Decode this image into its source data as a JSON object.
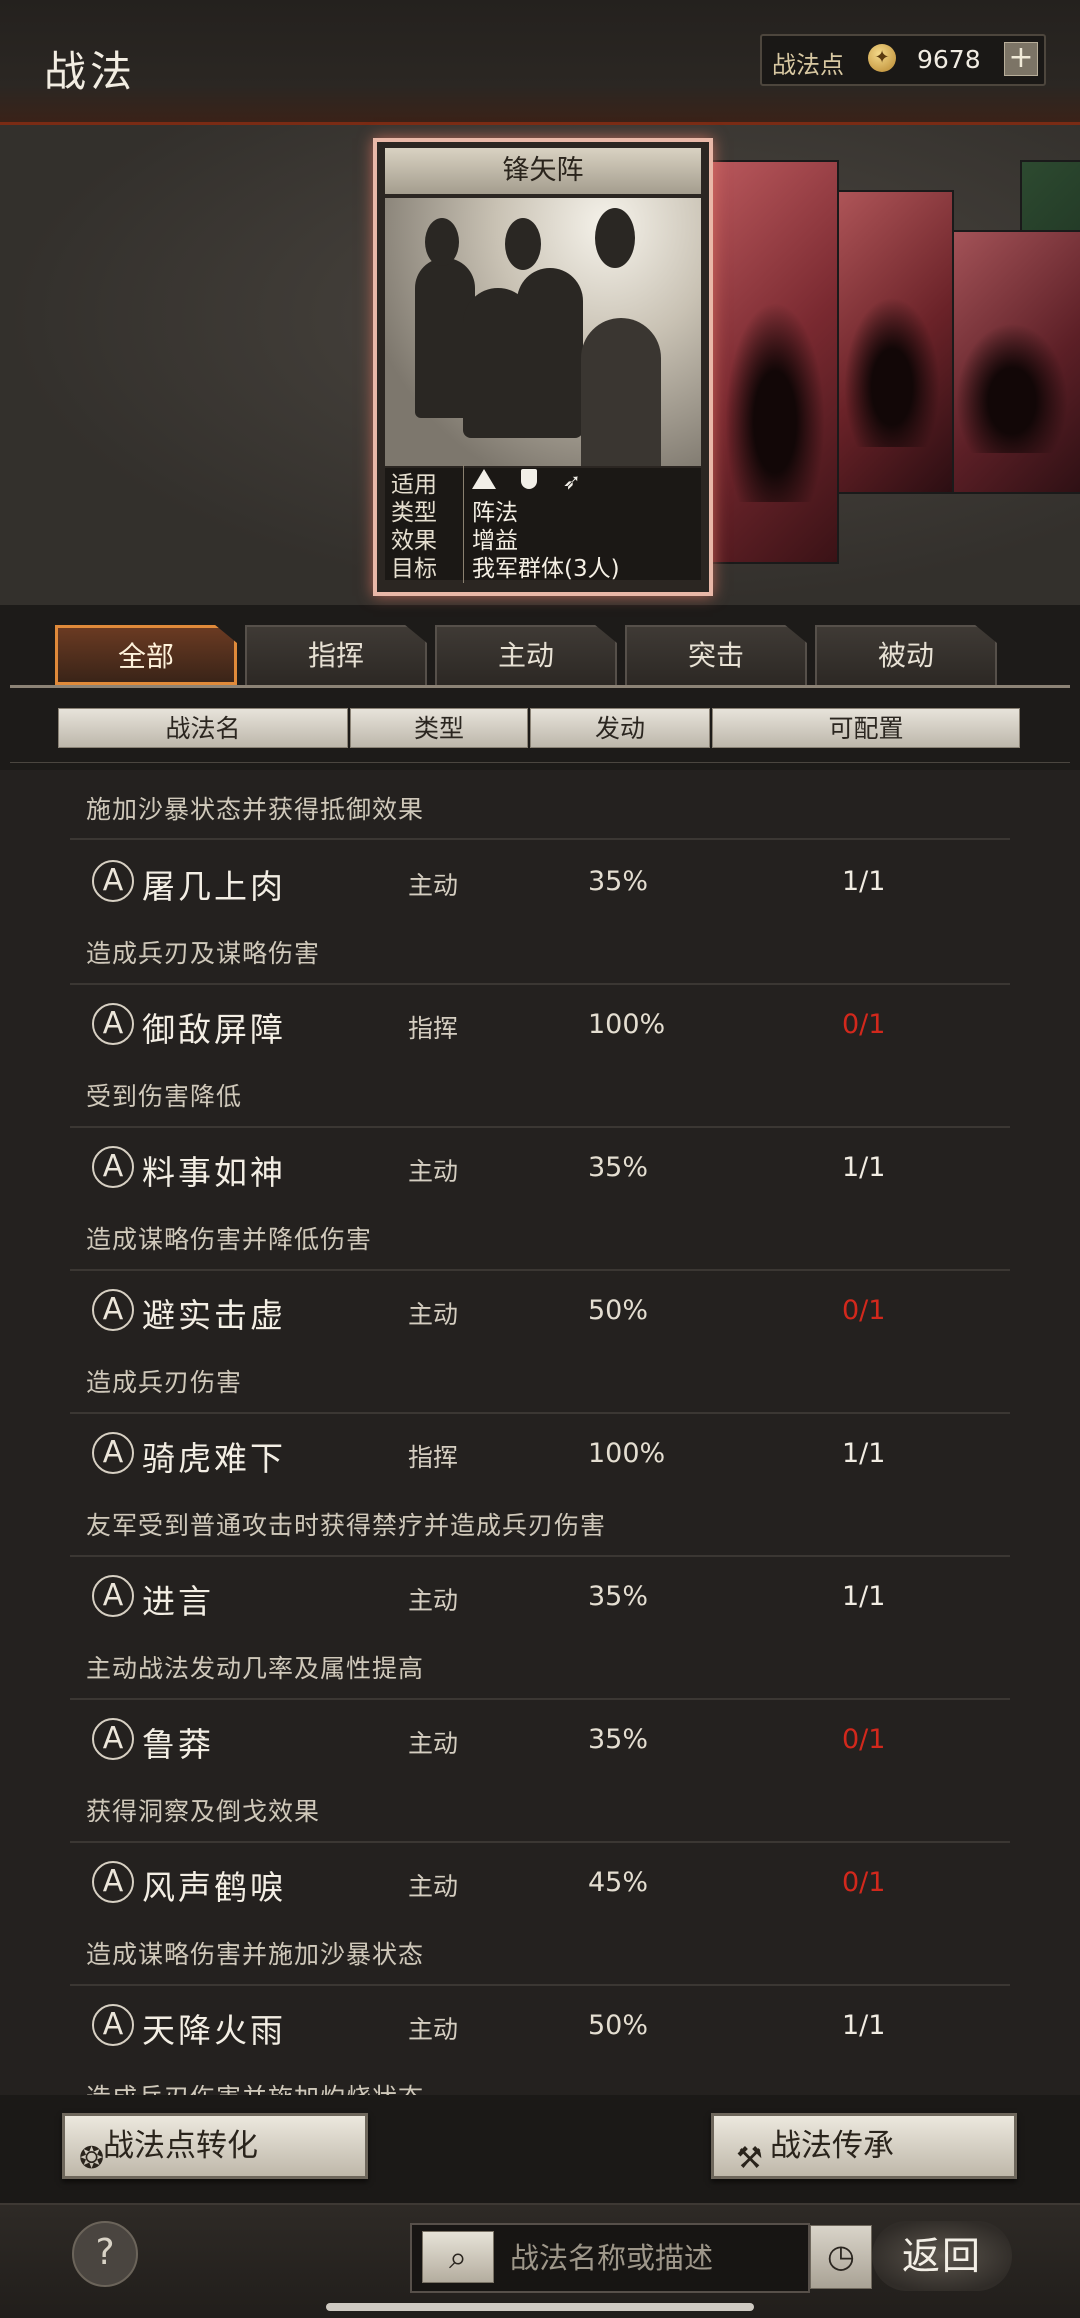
{
  "header": {
    "title": "战法",
    "points_label": "战法点",
    "points_value": "9678",
    "plus_label": "+"
  },
  "featured_card": {
    "name": "锋矢阵",
    "info": [
      {
        "key": "适用",
        "value": ""
      },
      {
        "key": "类型",
        "value": "阵法"
      },
      {
        "key": "效果",
        "value": "增益"
      },
      {
        "key": "目标",
        "value": "我军群体(3人)"
      }
    ]
  },
  "tabs": [
    "全部",
    "指挥",
    "主动",
    "突击",
    "被动"
  ],
  "active_tab": 0,
  "columns": [
    "战法名",
    "类型",
    "发动",
    "可配置"
  ],
  "top_desc": "施加沙暴状态并获得抵御效果",
  "entries": [
    {
      "badge": "A",
      "name": "屠几上肉",
      "type": "主动",
      "chance": "35%",
      "config": "1/1",
      "config_red": false,
      "desc": "造成兵刃及谋略伤害"
    },
    {
      "badge": "A",
      "name": "御敌屏障",
      "type": "指挥",
      "chance": "100%",
      "config": "0/1",
      "config_red": true,
      "desc": "受到伤害降低"
    },
    {
      "badge": "A",
      "name": "料事如神",
      "type": "主动",
      "chance": "35%",
      "config": "1/1",
      "config_red": false,
      "desc": "造成谋略伤害并降低伤害"
    },
    {
      "badge": "A",
      "name": "避实击虚",
      "type": "主动",
      "chance": "50%",
      "config": "0/1",
      "config_red": true,
      "desc": "造成兵刃伤害"
    },
    {
      "badge": "A",
      "name": "骑虎难下",
      "type": "指挥",
      "chance": "100%",
      "config": "1/1",
      "config_red": false,
      "desc": "友军受到普通攻击时获得禁疗并造成兵刃伤害"
    },
    {
      "badge": "A",
      "name": "进言",
      "type": "主动",
      "chance": "35%",
      "config": "1/1",
      "config_red": false,
      "desc": "主动战法发动几率及属性提高"
    },
    {
      "badge": "A",
      "name": "鲁莽",
      "type": "主动",
      "chance": "35%",
      "config": "0/1",
      "config_red": true,
      "desc": "获得洞察及倒戈效果"
    },
    {
      "badge": "A",
      "name": "风声鹤唳",
      "type": "主动",
      "chance": "45%",
      "config": "0/1",
      "config_red": true,
      "desc": "造成谋略伤害并施加沙暴状态"
    },
    {
      "badge": "A",
      "name": "天降火雨",
      "type": "主动",
      "chance": "50%",
      "config": "1/1",
      "config_red": false,
      "desc": "造成兵刃伤害并施加灼烧状态"
    }
  ],
  "bottom": {
    "convert_label": "战法点转化",
    "inherit_label": "战法传承",
    "help_label": "?",
    "search_placeholder": "战法名称或描述",
    "back_label": "返回"
  },
  "colors": {
    "accent": "#e08a3a",
    "red_count": "#d2281c",
    "card_glow": "#e9b8a8"
  }
}
